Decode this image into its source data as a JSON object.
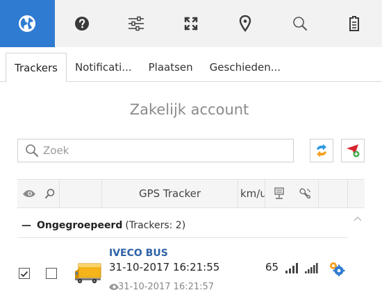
{
  "toolbar": {
    "items": [
      {
        "icon": "globe-icon",
        "active": true
      },
      {
        "icon": "help-icon",
        "active": false
      },
      {
        "icon": "sliders-icon",
        "active": false
      },
      {
        "icon": "fullscreen-icon",
        "active": false
      },
      {
        "icon": "map-pin-icon",
        "active": false
      },
      {
        "icon": "search-icon",
        "active": false
      },
      {
        "icon": "clipboard-icon",
        "active": false
      }
    ],
    "accent": "#2f7bd1"
  },
  "tabs": [
    {
      "label": "Trackers",
      "active": true
    },
    {
      "label": "Notificati...",
      "active": false
    },
    {
      "label": "Plaatsen",
      "active": false
    },
    {
      "label": "Geschieden...",
      "active": false
    }
  ],
  "account_title": "Zakelijk account",
  "search": {
    "placeholder": "Zoek",
    "value": ""
  },
  "table": {
    "headers": {
      "tracker": "GPS Tracker",
      "speed": "km/u"
    }
  },
  "group": {
    "name": "Ongegroepeerd",
    "count": "(Trackers: 2)"
  },
  "tracker": {
    "name": "IVECO BUS",
    "time": "31-10-2017 16:21:55",
    "speed": "65",
    "last_seen": "31-10-2017 16:21:57",
    "visible_checked": true,
    "selected_checked": false
  }
}
